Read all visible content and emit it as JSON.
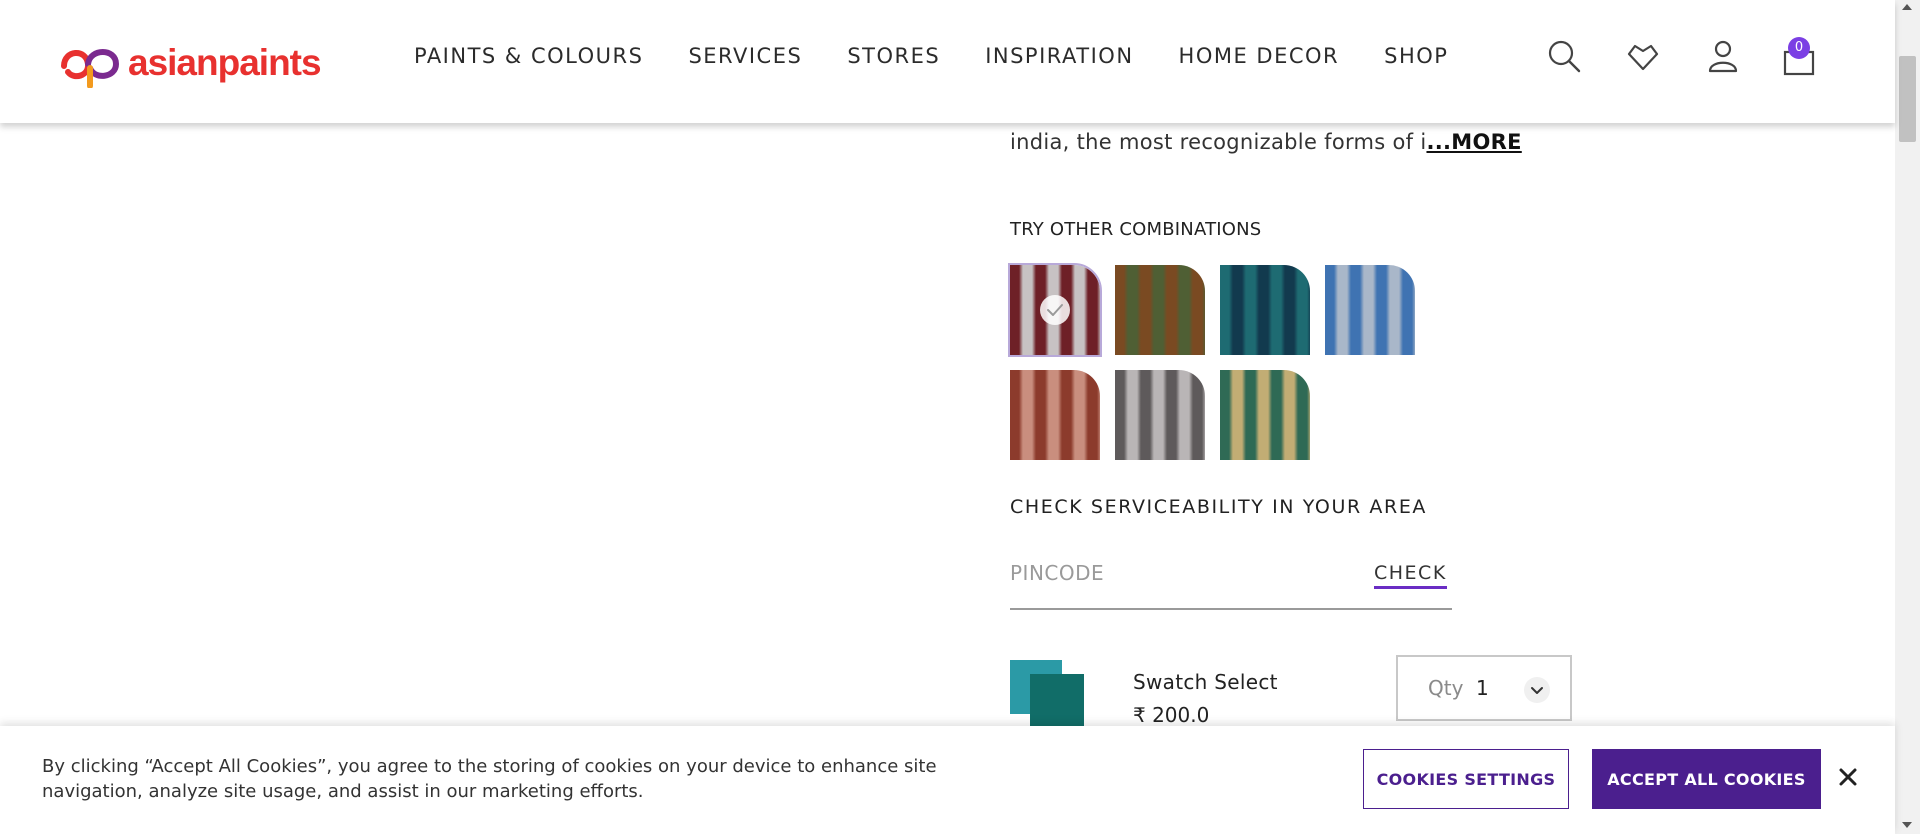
{
  "header": {
    "logo_text": "asianpaints",
    "nav": [
      "PAINTS & COLOURS",
      "SERVICES",
      "STORES",
      "INSPIRATION",
      "HOME DECOR",
      "SHOP"
    ],
    "cart_count": "0",
    "icons": [
      "search-icon",
      "wishlist-heart-icon",
      "user-icon",
      "cart-icon"
    ]
  },
  "product": {
    "description_snippet": "india, the most recognizable forms of i",
    "more_label": "...MORE",
    "combinations_title": "TRY OTHER COMBINATIONS",
    "combinations": [
      {
        "name": "maroon-grey",
        "colors": [
          "#6e2027",
          "#c7c2c3"
        ],
        "selected": true
      },
      {
        "name": "brown-green",
        "colors": [
          "#7a4a22",
          "#4f5f34"
        ],
        "selected": false
      },
      {
        "name": "teal-navy",
        "colors": [
          "#1e6b72",
          "#123a4e"
        ],
        "selected": false
      },
      {
        "name": "blue-grey",
        "colors": [
          "#3f73b2",
          "#a9b7c9"
        ],
        "selected": false
      },
      {
        "name": "rust-peach",
        "colors": [
          "#8c3b2c",
          "#c98e7e"
        ],
        "selected": false
      },
      {
        "name": "grey-charcoal",
        "colors": [
          "#5e5a5b",
          "#b9b5b6"
        ],
        "selected": false
      },
      {
        "name": "green-sand",
        "colors": [
          "#2f6a55",
          "#c2ad74"
        ],
        "selected": false
      }
    ],
    "serviceability_title": "CHECK SERVICEABILITY IN YOUR AREA",
    "pincode_placeholder": "PINCODE",
    "check_label": "CHECK",
    "swatch_name": "Swatch Select",
    "swatch_price": "₹ 200.0",
    "qty_label": "Qty",
    "qty_value": "1"
  },
  "cookie": {
    "text": "By clicking “Accept All Cookies”, you agree to the storing of cookies on your device to enhance site navigation, analyze site usage, and assist in our marketing efforts.",
    "settings_label": "COOKIES SETTINGS",
    "accept_label": "ACCEPT ALL COOKIES"
  },
  "colors": {
    "brand_purple": "#4b1f8e",
    "accent_purple": "#7b3fe4",
    "logo_red": "#e8312f"
  }
}
